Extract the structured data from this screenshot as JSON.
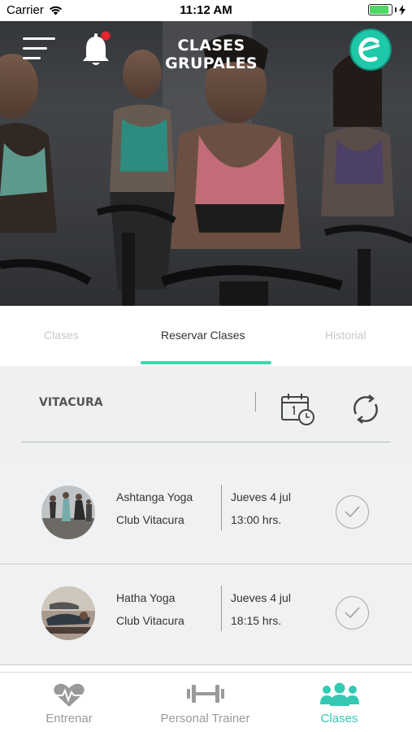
{
  "status_bar": {
    "carrier": "Carrier",
    "time": "11:12 AM",
    "battery_level": 0.9
  },
  "header": {
    "title": "CLASES GRUPALES"
  },
  "tabs": [
    {
      "label": "Clases",
      "active": false
    },
    {
      "label": "Reservar Clases",
      "active": true
    },
    {
      "label": "Historial",
      "active": false
    }
  ],
  "location": {
    "name": "VITACURA"
  },
  "classes": [
    {
      "name": "Ashtanga Yoga",
      "club": "Club Vitacura",
      "day": "Jueves  4 jul",
      "time": "13:00 hrs."
    },
    {
      "name": "Hatha Yoga",
      "club": "Club Vitacura",
      "day": "Jueves  4 jul",
      "time": "18:15 hrs."
    }
  ],
  "bottom_nav": [
    {
      "label": "Entrenar",
      "icon": "heart-pulse-icon",
      "active": false
    },
    {
      "label": "Personal Trainer",
      "icon": "dumbbell-icon",
      "active": false
    },
    {
      "label": "Clases",
      "icon": "group-icon",
      "active": true
    }
  ],
  "colors": {
    "accent": "#3ad8b0",
    "active_nav": "#35c9b4",
    "notification_dot": "#e8252b"
  }
}
